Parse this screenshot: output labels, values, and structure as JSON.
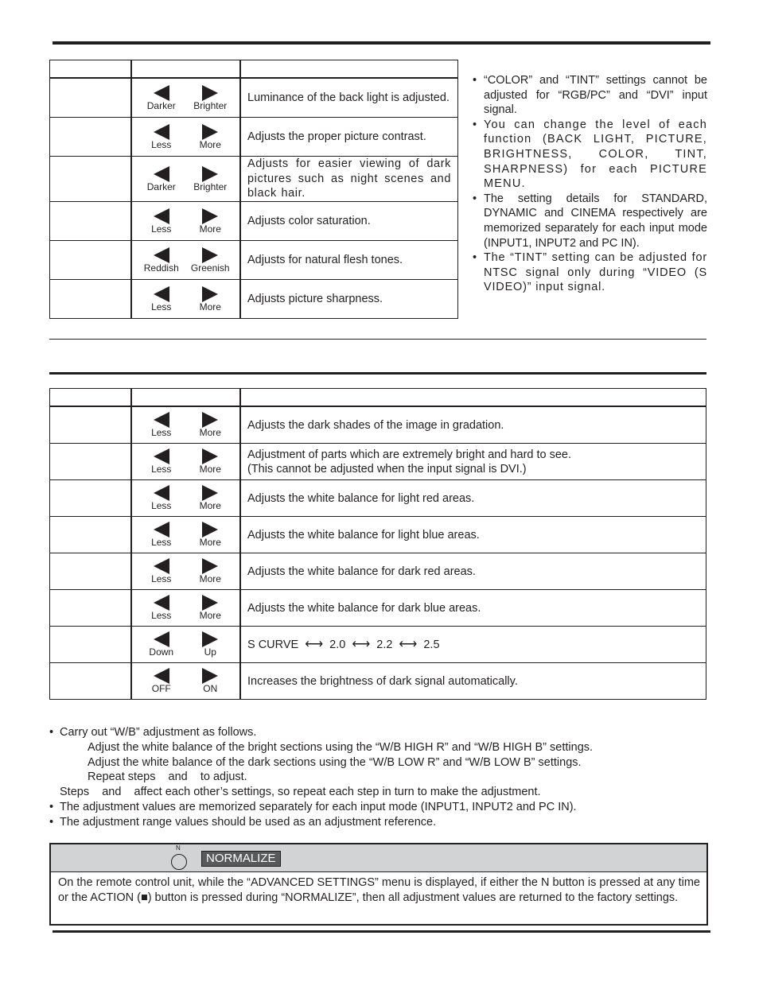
{
  "picture_table": {
    "header": [
      "",
      "",
      ""
    ],
    "rows": [
      {
        "name": "",
        "left_label": "Darker",
        "right_label": "Brighter",
        "description": "Luminance of the back light is adjusted."
      },
      {
        "name": "",
        "left_label": "Less",
        "right_label": "More",
        "description": "Adjusts the proper picture contrast."
      },
      {
        "name": "",
        "left_label": "Darker",
        "right_label": "Brighter",
        "description": "Adjusts for easier viewing of dark pictures such as night scenes and black hair."
      },
      {
        "name": "",
        "left_label": "Less",
        "right_label": "More",
        "description": "Adjusts color saturation."
      },
      {
        "name": "",
        "left_label": "Reddish",
        "right_label": "Greenish",
        "description": "Adjusts for natural flesh tones."
      },
      {
        "name": "",
        "left_label": "Less",
        "right_label": "More",
        "description": "Adjusts picture sharpness."
      }
    ]
  },
  "picture_notes": [
    "“COLOR” and “TINT” settings cannot be adjusted for “RGB/PC” and “DVI” input signal.",
    "You can change the level of each function (BACK LIGHT, PICTURE, BRIGHTNESS, COLOR, TINT, SHARPNESS) for each PICTURE MENU.",
    "The setting details for STANDARD, DYNAMIC and CINEMA respectively are memorized separately for each input mode (INPUT1, INPUT2 and PC IN).",
    "The “TINT” setting can be adjusted for NTSC signal only during “VIDEO (S VIDEO)” input signal."
  ],
  "advanced_table": {
    "header": [
      "",
      "",
      ""
    ],
    "rows": [
      {
        "name": "",
        "left_label": "Less",
        "right_label": "More",
        "description": "Adjusts the dark shades of the image in gradation."
      },
      {
        "name": "",
        "left_label": "Less",
        "right_label": "More",
        "description": "Adjustment of parts which are extremely bright and hard to see.",
        "description2": "(This cannot be adjusted when the input signal is DVI.)"
      },
      {
        "name": "",
        "left_label": "Less",
        "right_label": "More",
        "description": "Adjusts the white balance for light red areas."
      },
      {
        "name": "",
        "left_label": "Less",
        "right_label": "More",
        "description": "Adjusts the white balance for light blue areas."
      },
      {
        "name": "",
        "left_label": "Less",
        "right_label": "More",
        "description": "Adjusts the white balance for dark red areas."
      },
      {
        "name": "",
        "left_label": "Less",
        "right_label": "More",
        "description": "Adjusts the white balance for dark blue areas."
      },
      {
        "name": "",
        "left_label": "Down",
        "right_label": "Up",
        "gamma": [
          "S CURVE",
          "2.0",
          "2.2",
          "2.5"
        ],
        "gamma_separator": "⟷"
      },
      {
        "name": "",
        "left_label": "OFF",
        "right_label": "ON",
        "description": "Increases the brightness of dark signal automatically."
      }
    ]
  },
  "wb_notes": {
    "bullet1": "Carry out “W/B” adjustment as follows.",
    "step1": "Adjust the white balance of the bright sections using the “W/B HIGH R” and “W/B HIGH B” settings.",
    "step2": "Adjust the white balance of the dark sections using the “W/B LOW R” and “W/B LOW B” settings.",
    "step3": "Repeat steps    and    to adjust.",
    "steps_note": "Steps    and    affect each other’s settings, so repeat each step in turn to make the adjustment.",
    "bullet2": "The adjustment values are memorized separately for each input mode (INPUT1, INPUT2 and PC IN).",
    "bullet3": "The adjustment range values should be used as an adjustment reference.",
    "bullet_char": "•"
  },
  "normalize": {
    "button_letter": "N",
    "badge_label": "NORMALIZE",
    "body": "On the remote control unit, while the “ADVANCED SETTINGS” menu is displayed, if either the N button is pressed at any time or the ACTION (■) button is pressed during “NORMALIZE”, then all adjustment values are returned to the factory settings.",
    "colors": {
      "header_bg": "#d1d3d4",
      "badge_bg": "#58595b",
      "badge_text": "#ffffff"
    }
  }
}
